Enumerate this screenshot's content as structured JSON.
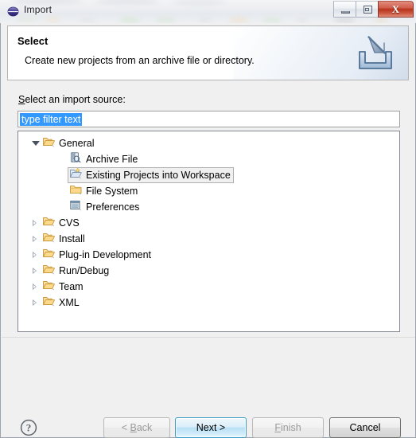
{
  "window": {
    "title": "Import",
    "app_icon": "eclipse-globe-icon",
    "controls": {
      "minimize": "minimize-button",
      "restore": "restore-button",
      "close": "close-button",
      "close_glyph": "X"
    }
  },
  "wizard_header": {
    "title": "Select",
    "description": "Create new projects from an archive file or directory.",
    "icon": "import-arrow-icon"
  },
  "form": {
    "source_label_prefix": "S",
    "source_label_rest": "elect an import source:",
    "filter": {
      "value": "type filter text",
      "placeholder": "type filter text",
      "selected": true
    }
  },
  "tree": {
    "items": [
      {
        "label": "General",
        "level": 0,
        "icon": "folder-open-icon",
        "state": "expanded",
        "selected": false
      },
      {
        "label": "Archive File",
        "level": 1,
        "icon": "archive-file-icon",
        "state": "leaf",
        "selected": false
      },
      {
        "label": "Existing Projects into Workspace",
        "level": 1,
        "icon": "import-project-icon",
        "state": "leaf",
        "selected": true
      },
      {
        "label": "File System",
        "level": 1,
        "icon": "folder-icon",
        "state": "leaf",
        "selected": false
      },
      {
        "label": "Preferences",
        "level": 1,
        "icon": "preferences-icon",
        "state": "leaf",
        "selected": false
      },
      {
        "label": "CVS",
        "level": 0,
        "icon": "folder-open-icon",
        "state": "collapsed",
        "selected": false
      },
      {
        "label": "Install",
        "level": 0,
        "icon": "folder-open-icon",
        "state": "collapsed",
        "selected": false
      },
      {
        "label": "Plug-in Development",
        "level": 0,
        "icon": "folder-open-icon",
        "state": "collapsed",
        "selected": false
      },
      {
        "label": "Run/Debug",
        "level": 0,
        "icon": "folder-open-icon",
        "state": "collapsed",
        "selected": false
      },
      {
        "label": "Team",
        "level": 0,
        "icon": "folder-open-icon",
        "state": "collapsed",
        "selected": false
      },
      {
        "label": "XML",
        "level": 0,
        "icon": "folder-open-icon",
        "state": "collapsed",
        "selected": false
      }
    ]
  },
  "footer": {
    "help_icon": "help-question-icon",
    "buttons": {
      "back": {
        "prefix": "< ",
        "mnemonic": "B",
        "suffix": "ack",
        "enabled": false,
        "default": false
      },
      "next": {
        "prefix": "",
        "mnemonic": "",
        "suffix": "Next >",
        "enabled": true,
        "default": true
      },
      "finish": {
        "prefix": "",
        "mnemonic": "F",
        "suffix": "inish",
        "enabled": false,
        "default": false
      },
      "cancel": {
        "prefix": "",
        "mnemonic": "",
        "suffix": "Cancel",
        "enabled": true,
        "default": false
      }
    }
  },
  "colors": {
    "selection_blue": "#3399ff",
    "default_button_border": "#3c9ec5",
    "close_button_red": "#b8331c",
    "folder_orange": "#f5c378",
    "dialog_bg": "#f0f0f0"
  }
}
